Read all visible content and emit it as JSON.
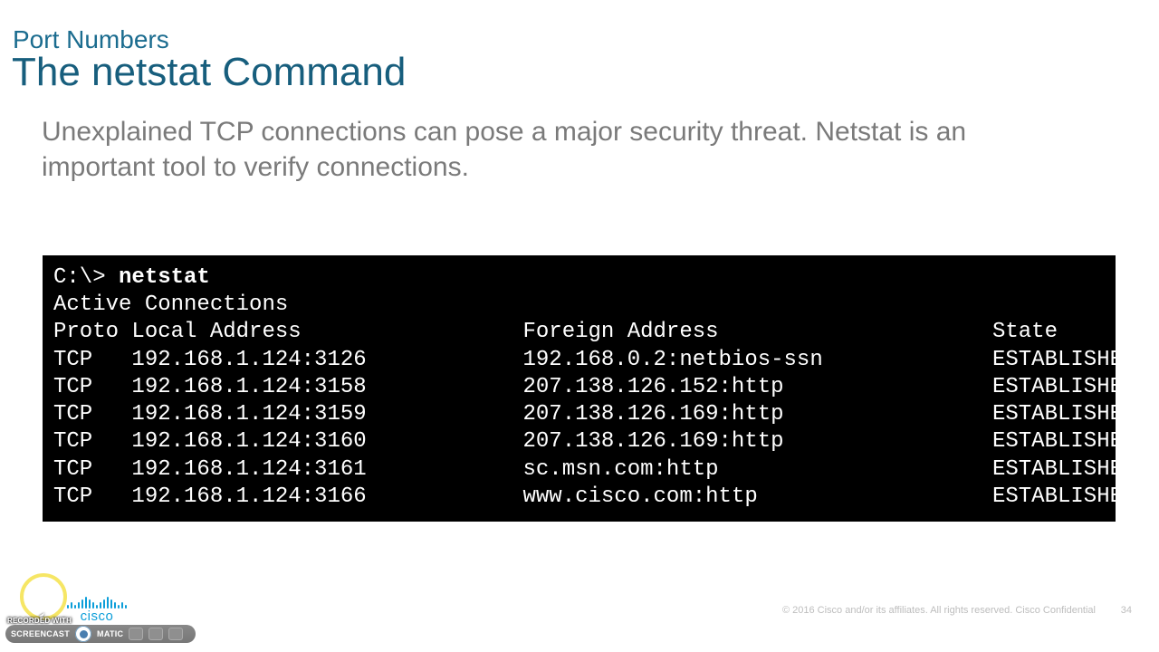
{
  "header": {
    "subtitle": "Port Numbers",
    "title": "The netstat Command"
  },
  "body": "Unexplained TCP connections can pose a major security threat. Netstat is an important tool to verify connections.",
  "terminal": {
    "prompt": "C:\\> ",
    "command": "netstat",
    "active_label": "Active Connections",
    "headers": {
      "proto": "Proto",
      "local": "Local Address",
      "foreign": "Foreign Address",
      "state": "State"
    },
    "rows": [
      {
        "proto": "TCP",
        "local": "192.168.1.124:3126",
        "foreign": "192.168.0.2:netbios-ssn",
        "state": "ESTABLISHED"
      },
      {
        "proto": "TCP",
        "local": "192.168.1.124:3158",
        "foreign": "207.138.126.152:http",
        "state": "ESTABLISHED"
      },
      {
        "proto": "TCP",
        "local": "192.168.1.124:3159",
        "foreign": "207.138.126.169:http",
        "state": "ESTABLISHED"
      },
      {
        "proto": "TCP",
        "local": "192.168.1.124:3160",
        "foreign": "207.138.126.169:http",
        "state": "ESTABLISHED"
      },
      {
        "proto": "TCP",
        "local": "192.168.1.124:3161",
        "foreign": "sc.msn.com:http",
        "state": "ESTABLISHED"
      },
      {
        "proto": "TCP",
        "local": "192.168.1.124:3166",
        "foreign": "www.cisco.com:http",
        "state": "ESTABLISHED"
      }
    ]
  },
  "branding": {
    "cisco": "cisco",
    "footer": "© 2016  Cisco and/or its affiliates. All rights reserved.   Cisco Confidential",
    "slide_number": "34",
    "recorder_watermark": "RECORDED WITH",
    "recorder_brand_a": "SCREENCAST",
    "recorder_brand_b": "MATIC"
  }
}
